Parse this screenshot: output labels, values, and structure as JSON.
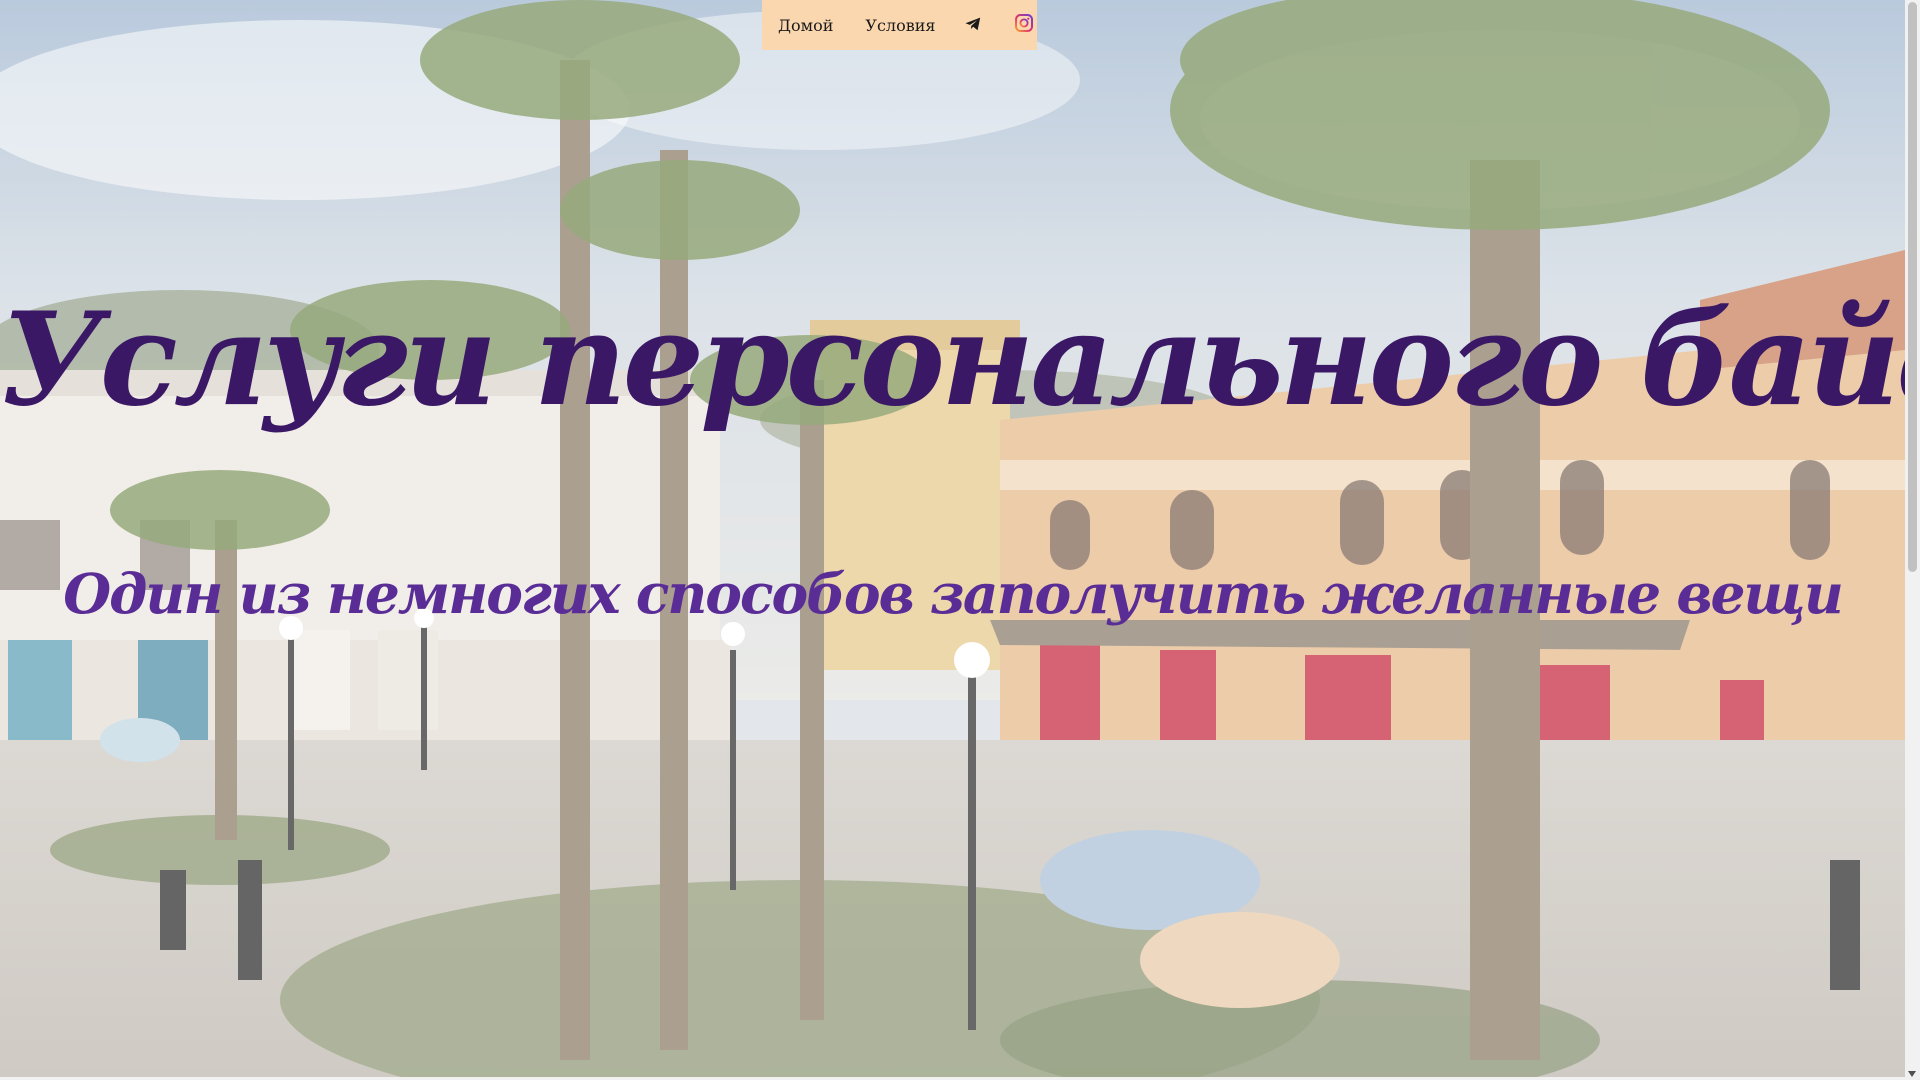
{
  "nav": {
    "home_label": "Домой",
    "terms_label": "Условия",
    "telegram_icon": "telegram-icon",
    "instagram_icon": "instagram-icon"
  },
  "hero": {
    "title": "Услуги персонального байера",
    "subtitle": "Один из немногих способов заполучить желанные вещи"
  },
  "colors": {
    "nav_background": "#fad7ae",
    "title_color": "#3a1866",
    "subtitle_color": "#5a2d96"
  }
}
